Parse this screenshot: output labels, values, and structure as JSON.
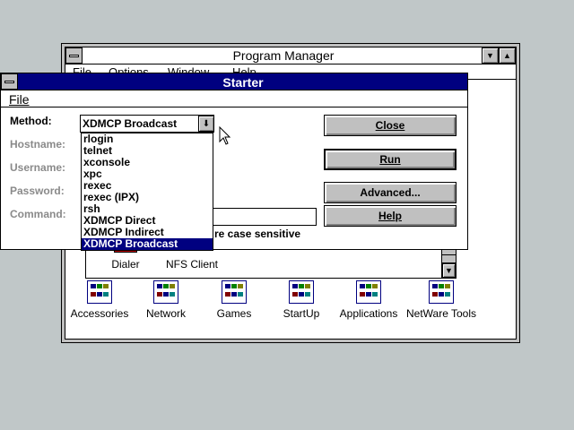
{
  "program_manager": {
    "title": "Program Manager",
    "menu": [
      "File",
      "Options",
      "Window",
      "Help"
    ],
    "group_window": {
      "items_top": [
        {
          "label": "Dialer",
          "icon": "dialer-icon"
        },
        {
          "label": "NFS Client",
          "icon": "nfs-client-icon"
        }
      ],
      "scroll_down": "▼"
    },
    "groups": [
      {
        "label": "Accessories",
        "icon": "program-group-icon"
      },
      {
        "label": "Network",
        "icon": "program-group-icon"
      },
      {
        "label": "Games",
        "icon": "program-group-icon"
      },
      {
        "label": "StartUp",
        "icon": "program-group-icon"
      },
      {
        "label": "Applications",
        "icon": "program-group-icon"
      },
      {
        "label": "NetWare Tools",
        "icon": "program-group-icon"
      }
    ]
  },
  "starter": {
    "title": "Starter",
    "menu_file": "File",
    "fields": {
      "method": "Method:",
      "hostname": "Hostname:",
      "username": "Username:",
      "password": "Password:",
      "command": "Command:"
    },
    "method_value": "XDMCP Broadcast",
    "method_options": [
      "rlogin",
      "telnet",
      "xconsole",
      "xpc",
      "rexec",
      "rexec (IPX)",
      "rsh",
      "XDMCP Direct",
      "XDMCP Indirect",
      "XDMCP Broadcast"
    ],
    "selected_option_index": 9,
    "case_sensitive_text": "re case sensitive",
    "buttons": {
      "close": "Close",
      "run": "Run",
      "advanced": "Advanced...",
      "help": "Help"
    }
  },
  "colors": {
    "desktop": "#c0c7c8",
    "active_title": "#000080",
    "inactive_title": "#ffffff",
    "selection": "#000080"
  }
}
